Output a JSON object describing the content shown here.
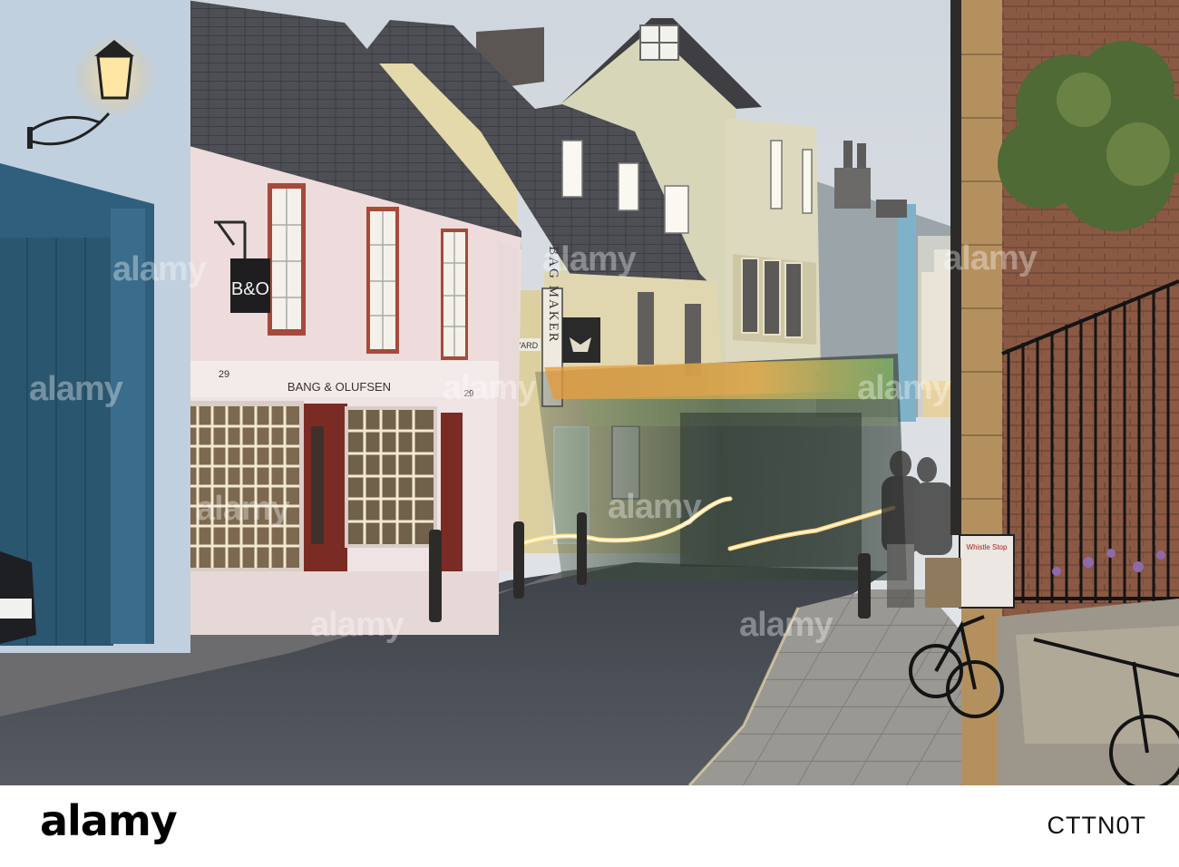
{
  "photo": {
    "shop_sign_logo": "B&O",
    "shop_fascia": "BANG & OLUFSEN",
    "shop_number_left": "29",
    "shop_number_right": "29",
    "hanging_sign_vertical": "BAG MAKER",
    "yard_sign": "YARD",
    "bike_basket_label": "Whistle Stop"
  },
  "watermark": {
    "text": "alamy"
  },
  "credit_bar": {
    "logo": "alamy",
    "stock_id": "CTTN0T"
  },
  "colors": {
    "sky": "#d9dee3",
    "street": "#4a4d55",
    "pink_shop": "#efd8d6",
    "door_red": "#7a2b24",
    "blue_gate": "#2f5f7c",
    "brick": "#8a5a44"
  }
}
